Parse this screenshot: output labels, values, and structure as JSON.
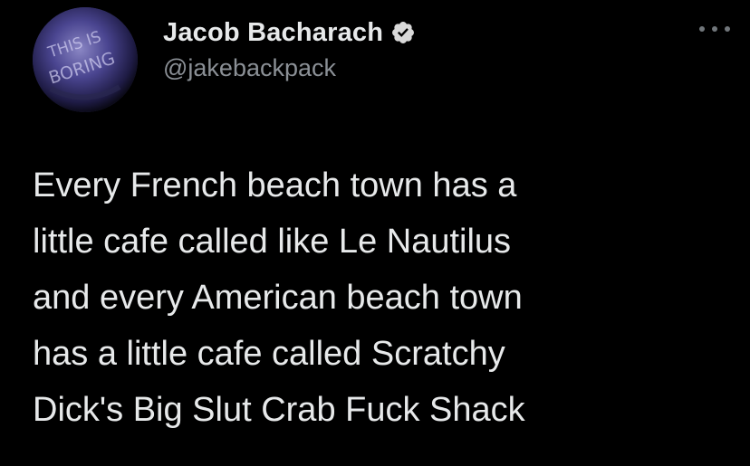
{
  "tweet": {
    "author": {
      "display_name": "Jacob Bacharach",
      "handle": "@jakebackpack",
      "verified": true,
      "avatar_text": "THIS IS BORING",
      "avatar_icon": "profile-avatar"
    },
    "more_icon": "more-options-icon",
    "text": "Every French beach town has a\nlittle cafe called like Le Nautilus\nand every American beach town\nhas a little cafe called Scratchy\nDick's Big Slut Crab Fuck Shack"
  },
  "colors": {
    "background": "#000000",
    "text": "#e7e9ea",
    "secondary_text": "#8b9096",
    "verified_badge": "#d9d9d9"
  }
}
